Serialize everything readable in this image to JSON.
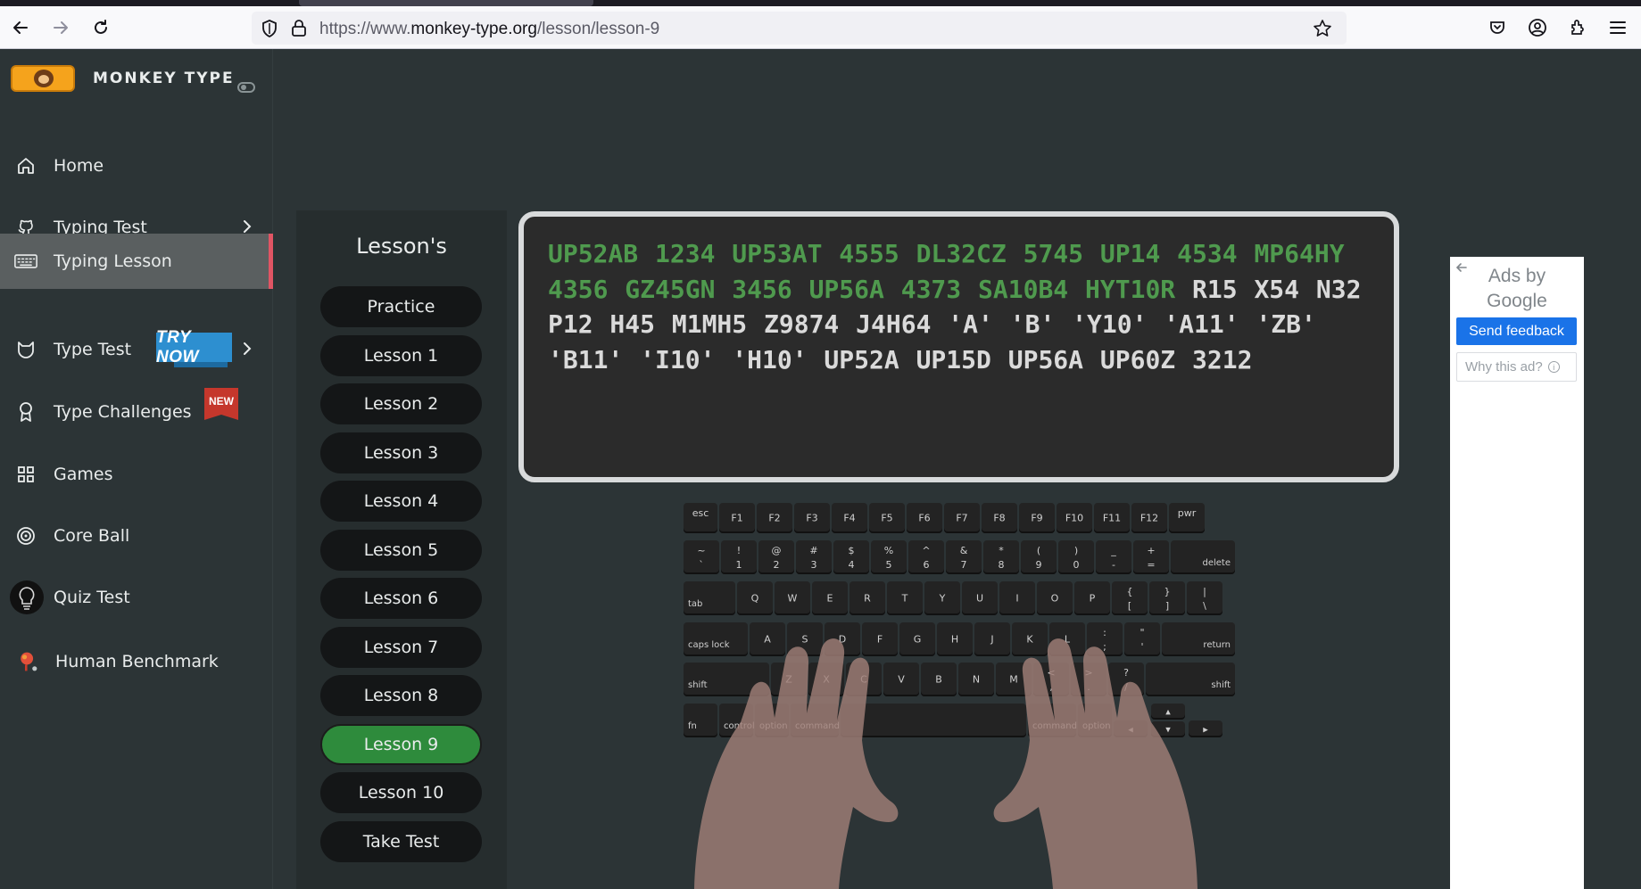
{
  "browser": {
    "url_prefix": "https://www.",
    "url_domain": "monkey-type.org",
    "url_path": "/lesson/lesson-9"
  },
  "sidebar": {
    "brand": "MONKEY TYPE",
    "items": [
      {
        "label": "Home",
        "icon": "home-icon"
      },
      {
        "label": "Typing Test",
        "icon": "github-icon"
      },
      {
        "label": "Typing Lesson",
        "icon": "keyboard-icon"
      },
      {
        "label": "Type Test",
        "icon": "cat-icon",
        "badge": "TRY NOW"
      },
      {
        "label": "Type Challenges",
        "icon": "award-icon",
        "badge": "NEW"
      },
      {
        "label": "Games",
        "icon": "grid-icon"
      },
      {
        "label": "Core Ball",
        "icon": "target-icon"
      },
      {
        "label": "Quiz Test",
        "icon": "lightbulb-icon"
      },
      {
        "label": "Human Benchmark",
        "icon": "brain-icon"
      }
    ]
  },
  "lessons": {
    "title": "Lesson's",
    "items": [
      "Practice",
      "Lesson 1",
      "Lesson 2",
      "Lesson 3",
      "Lesson 4",
      "Lesson 5",
      "Lesson 6",
      "Lesson 7",
      "Lesson 8",
      "Lesson 9",
      "Lesson 10",
      "Take Test"
    ],
    "active": "Lesson 9"
  },
  "typing": {
    "typed": "UP52AB  1234  UP53AT  4555  DL32CZ  5745  UP14  4534 MP64HY 4356 GZ45GN 3456 UP56A 4373 SA10B4 HYT10R",
    "untyped": " R15 X54 N32 P12 H45 M1MH5 Z9874 J4H64 'A' 'B' 'Y10' 'A11' 'ZB' 'B11' 'I10' 'H10' UP52A UP15D UP56A UP60Z 3212",
    "typed_color": "#4f9a4e",
    "untyped_color": "#dadada"
  },
  "keyboard": {
    "fn_row": [
      "esc",
      "F1",
      "F2",
      "F3",
      "F4",
      "F5",
      "F6",
      "F7",
      "F8",
      "F9",
      "F10",
      "F11",
      "F12",
      "pwr"
    ],
    "num_row": [
      [
        "~",
        "`"
      ],
      [
        "!",
        "1"
      ],
      [
        "@",
        "2"
      ],
      [
        "#",
        "3"
      ],
      [
        "$",
        "4"
      ],
      [
        "%",
        "5"
      ],
      [
        "^",
        "6"
      ],
      [
        "&",
        "7"
      ],
      [
        "*",
        "8"
      ],
      [
        "(",
        "9"
      ],
      [
        ")",
        "0"
      ],
      [
        "_",
        "-"
      ],
      [
        "+",
        "="
      ]
    ],
    "delete": "delete",
    "tab": "tab",
    "q_row": [
      "Q",
      "W",
      "E",
      "R",
      "T",
      "Y",
      "U",
      "I",
      "O",
      "P"
    ],
    "q_row_sym": [
      [
        "{",
        "["
      ],
      [
        "}",
        "]"
      ],
      [
        "|",
        "\\"
      ]
    ],
    "caps": "caps lock",
    "a_row": [
      "A",
      "S",
      "D",
      "F",
      "G",
      "H",
      "J",
      "K",
      "L"
    ],
    "a_row_sym": [
      [
        ":",
        ";"
      ],
      [
        "\"",
        "'"
      ]
    ],
    "return": "return",
    "shift": "shift",
    "z_row": [
      "Z",
      "X",
      "C",
      "V",
      "B",
      "N",
      "M"
    ],
    "z_row_sym": [
      [
        "<",
        ","
      ],
      [
        ">",
        "."
      ],
      [
        "?",
        "/"
      ]
    ],
    "bottom": [
      "fn",
      "control",
      "option",
      "command",
      "command",
      "option"
    ],
    "arrows": [
      "◂",
      "▴",
      "▾",
      "▸"
    ]
  },
  "ad": {
    "ads_by": "Ads by",
    "google": "Google",
    "send_feedback": "Send feedback",
    "why": "Why this ad?"
  }
}
